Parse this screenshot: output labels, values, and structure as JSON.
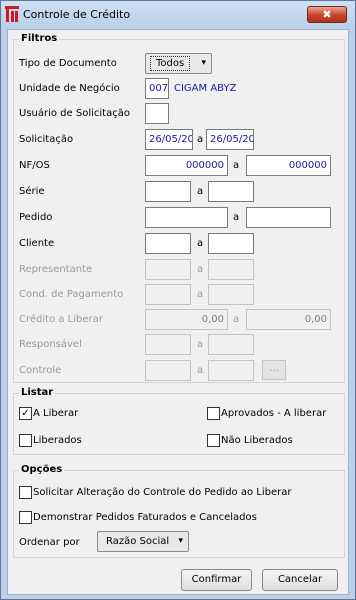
{
  "window": {
    "title": "Controle de Crédito",
    "close_label": "✖"
  },
  "filtros": {
    "title": "Filtros",
    "tipo_documento": {
      "label": "Tipo de Documento",
      "value": "Todos"
    },
    "unidade_negocio": {
      "label": "Unidade de Negócio",
      "code": "007",
      "name": "CIGAM ABYZ"
    },
    "usuario_solicitacao": {
      "label": "Usuário de Solicitação",
      "value": ""
    },
    "solicitacao": {
      "label": "Solicitação",
      "from": "26/05/20",
      "sep": "a",
      "to": "26/05/20"
    },
    "nf_os": {
      "label": "NF/OS",
      "from": "000000",
      "sep": "a",
      "to": "000000"
    },
    "serie": {
      "label": "Série",
      "from": "",
      "sep": "a",
      "to": ""
    },
    "pedido": {
      "label": "Pedido",
      "from": "",
      "sep": "a",
      "to": ""
    },
    "cliente": {
      "label": "Cliente",
      "from": "",
      "sep": "a",
      "to": ""
    },
    "representante": {
      "label": "Representante",
      "sep": "a"
    },
    "cond_pagamento": {
      "label": "Cond. de Pagamento",
      "sep": "a"
    },
    "credito_liberar": {
      "label": "Crédito a Liberar",
      "from": "0,00",
      "sep": "a",
      "to": "0,00"
    },
    "responsavel": {
      "label": "Responsável",
      "sep": "a"
    },
    "controle": {
      "label": "Controle",
      "sep": "a",
      "button": "..."
    }
  },
  "listar": {
    "title": "Listar",
    "a_liberar": {
      "label": "A Liberar",
      "checked": true
    },
    "aprovados": {
      "label": "Aprovados - A liberar",
      "checked": false
    },
    "liberados": {
      "label": "Liberados",
      "checked": false
    },
    "nao_liberados": {
      "label": "Não Liberados",
      "checked": false
    }
  },
  "opcoes": {
    "title": "Opções",
    "solicitar_alteracao": {
      "label": "Solicitar Alteração do Controle do Pedido ao Liberar",
      "checked": false
    },
    "demonstrar_pedidos": {
      "label": "Demonstrar Pedidos Faturados e Cancelados",
      "checked": false
    },
    "ordenar_por": {
      "label": "Ordenar por",
      "value": "Razão Social"
    }
  },
  "buttons": {
    "confirmar": "Confirmar",
    "cancelar": "Cancelar"
  }
}
